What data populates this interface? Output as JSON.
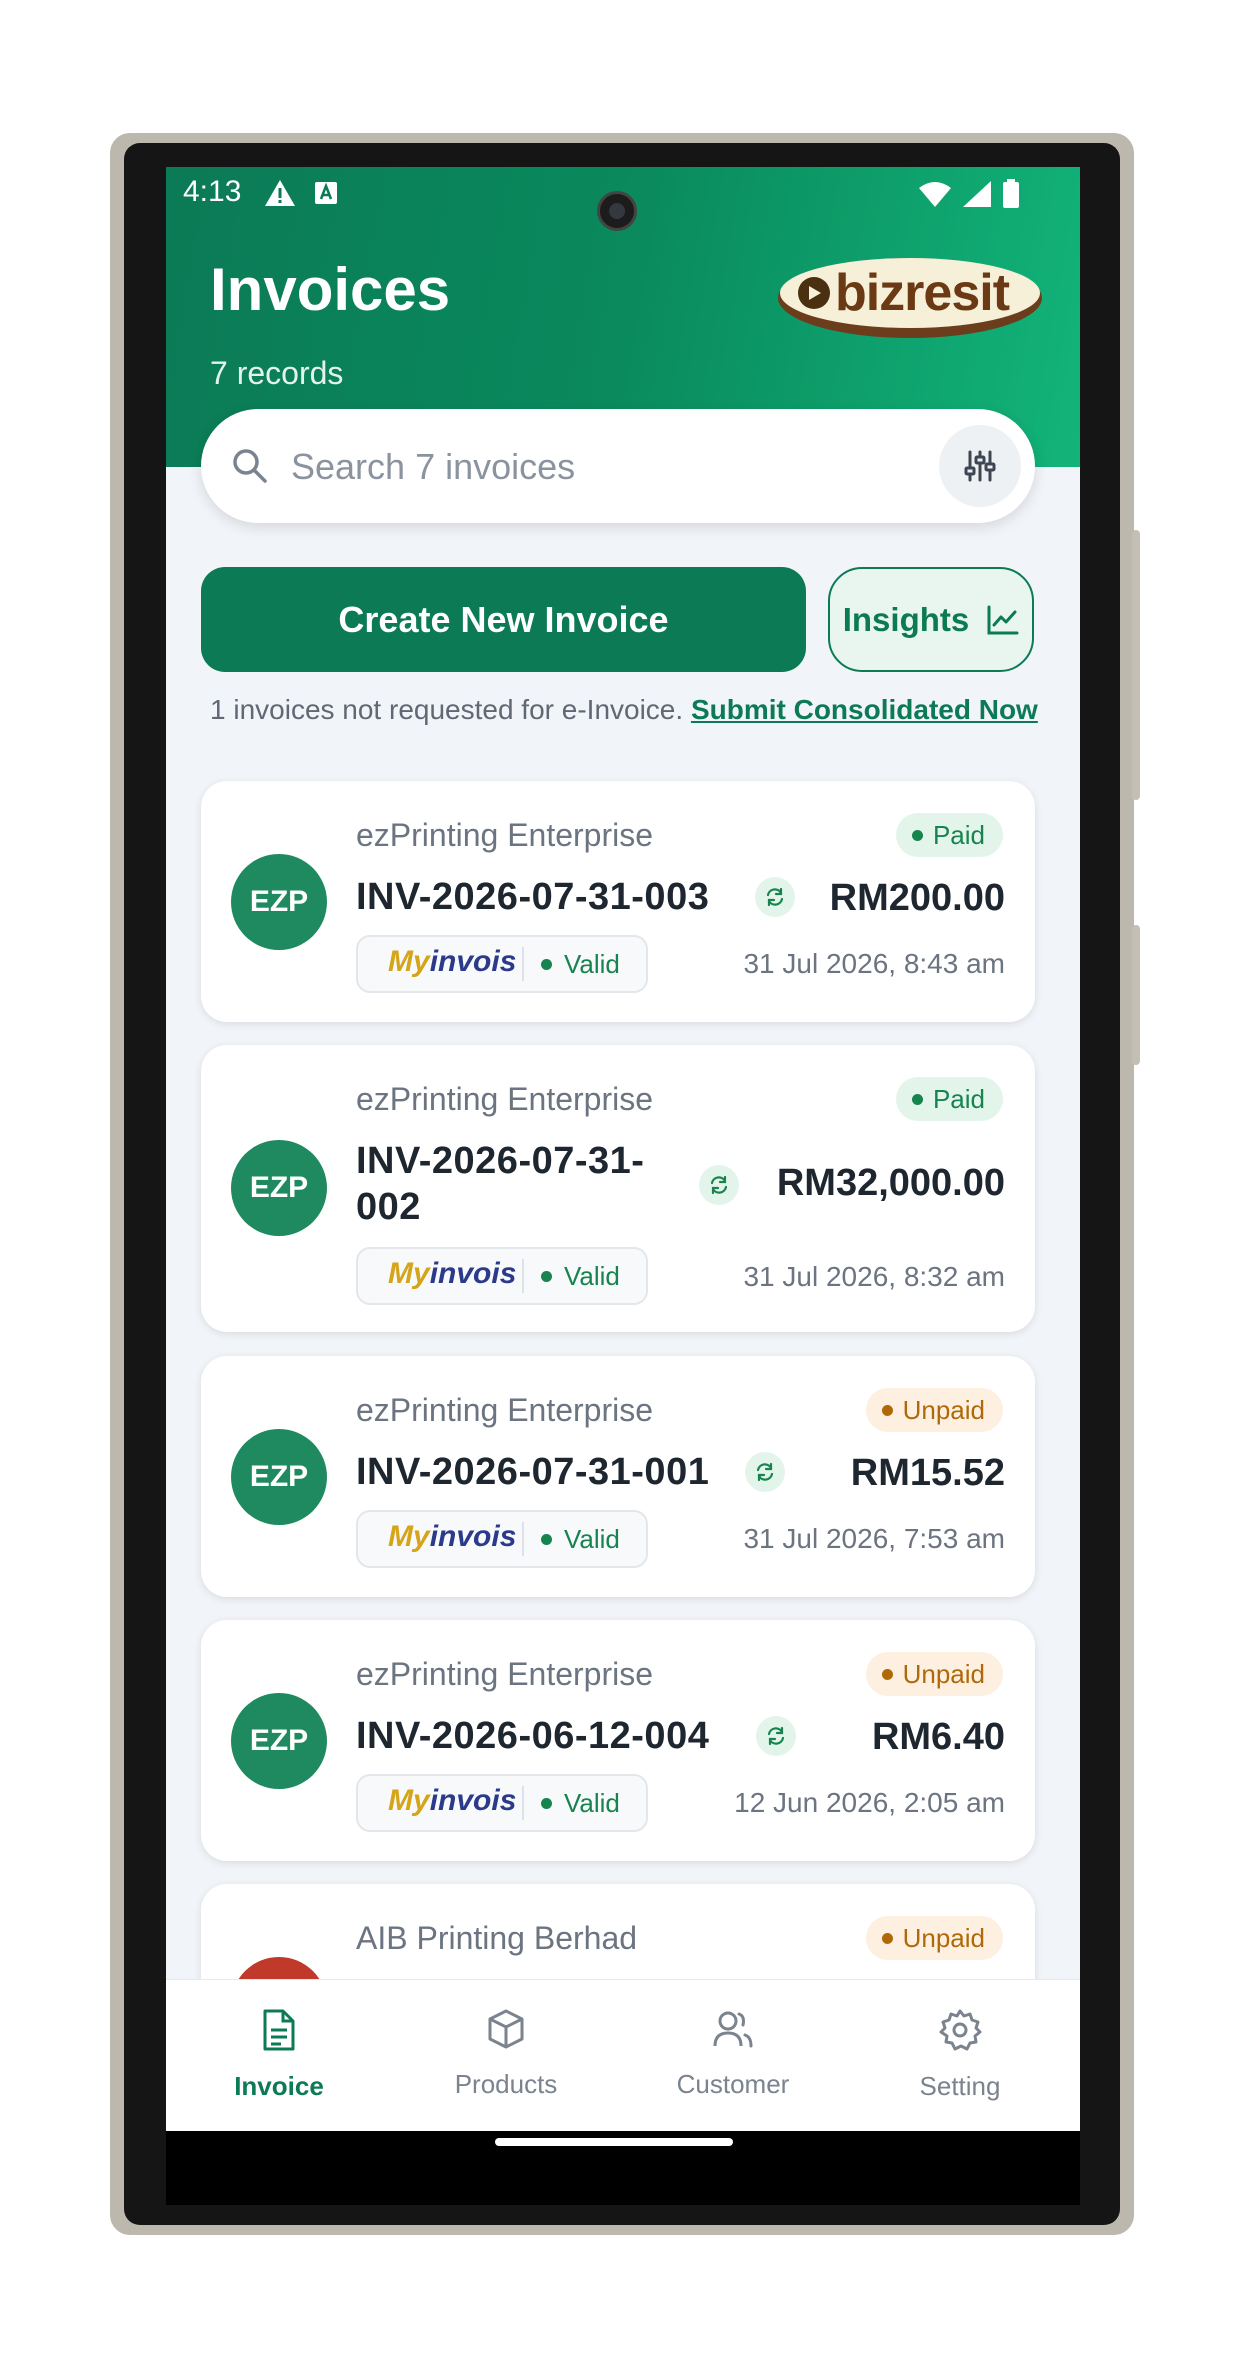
{
  "status": {
    "time": "4:13"
  },
  "header": {
    "title": "Invoices",
    "records": "7 records",
    "logo_text": "bizresit"
  },
  "search": {
    "placeholder": "Search 7 invoices"
  },
  "actions": {
    "create_label": "Create New Invoice",
    "insights_label": "Insights"
  },
  "notice": {
    "text": "1 invoices not requested for e-Invoice.",
    "link": "Submit Consolidated Now"
  },
  "invoices": [
    {
      "initials": "EZP",
      "company": "ezPrinting Enterprise",
      "status": "Paid",
      "number": "INV-2026-07-31-003",
      "amount": "RM200.00",
      "einvoice_logo": "Myinvois",
      "einvoice_status": "Valid",
      "date": "31 Jul 2026, 8:43 am"
    },
    {
      "initials": "EZP",
      "company": "ezPrinting Enterprise",
      "status": "Paid",
      "number_line1": "INV-2026-07-31-",
      "number_line2": "002",
      "amount": "RM32,000.00",
      "einvoice_logo": "Myinvois",
      "einvoice_status": "Valid",
      "date": "31 Jul 2026, 8:32 am"
    },
    {
      "initials": "EZP",
      "company": "ezPrinting Enterprise",
      "status": "Unpaid",
      "number": "INV-2026-07-31-001",
      "amount": "RM15.52",
      "einvoice_logo": "Myinvois",
      "einvoice_status": "Valid",
      "date": "31 Jul 2026, 7:53 am"
    },
    {
      "initials": "EZP",
      "company": "ezPrinting Enterprise",
      "status": "Unpaid",
      "number": "INV-2026-06-12-004",
      "amount": "RM6.40",
      "einvoice_logo": "Myinvois",
      "einvoice_status": "Valid",
      "date": "12 Jun 2026, 2:05 am"
    },
    {
      "company": "AIB Printing Berhad",
      "status": "Unpaid"
    }
  ],
  "nav": {
    "items": [
      {
        "label": "Invoice",
        "icon": "document-icon",
        "active": true
      },
      {
        "label": "Products",
        "icon": "box-icon"
      },
      {
        "label": "Customer",
        "icon": "users-icon"
      },
      {
        "label": "Setting",
        "icon": "gear-icon"
      }
    ]
  },
  "colors": {
    "primary": "#0c7a55",
    "header_gradient_end": "#12b47a",
    "paid": "#17844f",
    "unpaid": "#b0690a",
    "avatar_red": "#c0392b"
  }
}
